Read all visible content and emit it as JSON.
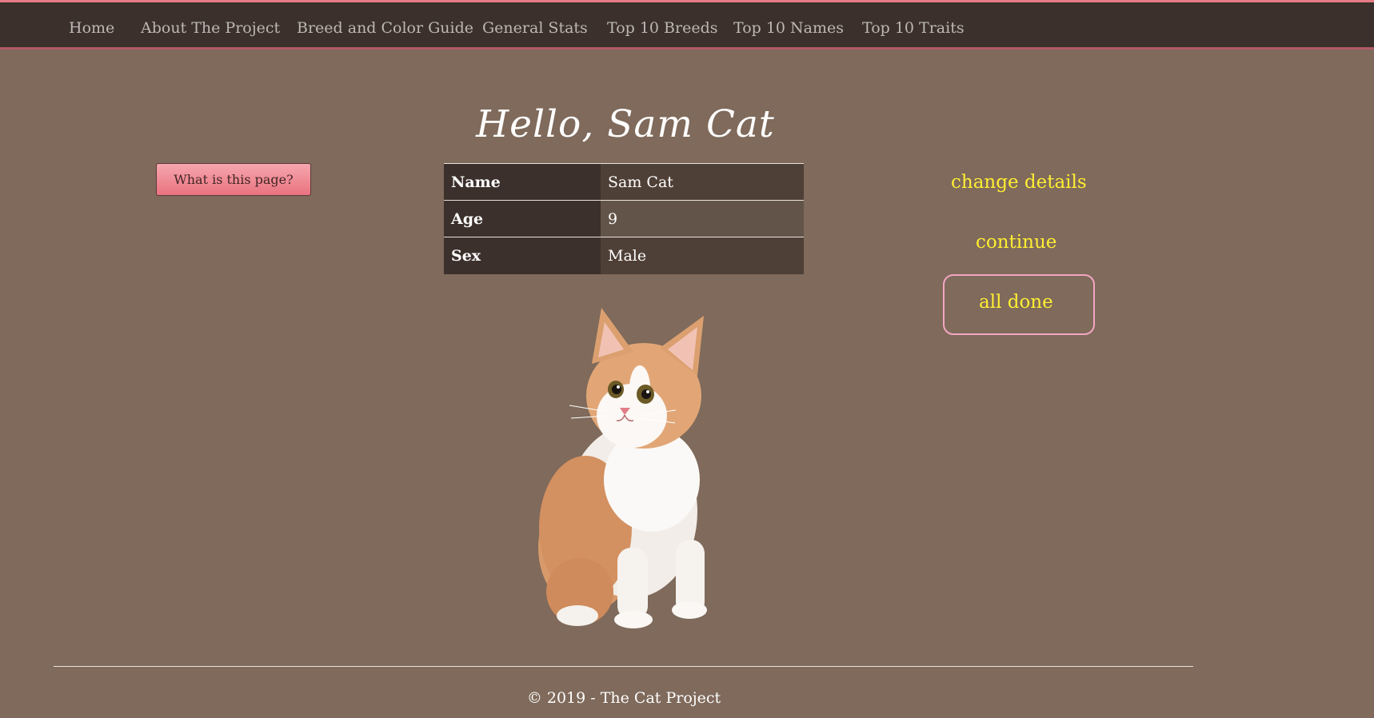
{
  "nav": {
    "items": [
      {
        "label": "Home"
      },
      {
        "label": "About The Project"
      },
      {
        "label": "Breed and Color Guide"
      },
      {
        "label": "General Stats"
      },
      {
        "label": "Top 10 Breeds"
      },
      {
        "label": "Top 10 Names"
      },
      {
        "label": "Top 10 Traits"
      }
    ]
  },
  "main": {
    "title": "Hello, Sam Cat",
    "help_button": "What is this page?",
    "details": [
      {
        "label": "Name",
        "value": "Sam Cat"
      },
      {
        "label": "Age",
        "value": "9"
      },
      {
        "label": "Sex",
        "value": "Male"
      }
    ],
    "actions": {
      "change": "change details",
      "continue": "continue",
      "done": "all done"
    }
  },
  "footer": {
    "text": "© 2019 - The Cat Project"
  },
  "colors": {
    "background": "#7f6a5b",
    "nav_background": "#3b302b",
    "nav_accent": "#e87c86",
    "link_yellow": "#ffee33",
    "done_border": "#f4a6c3"
  }
}
